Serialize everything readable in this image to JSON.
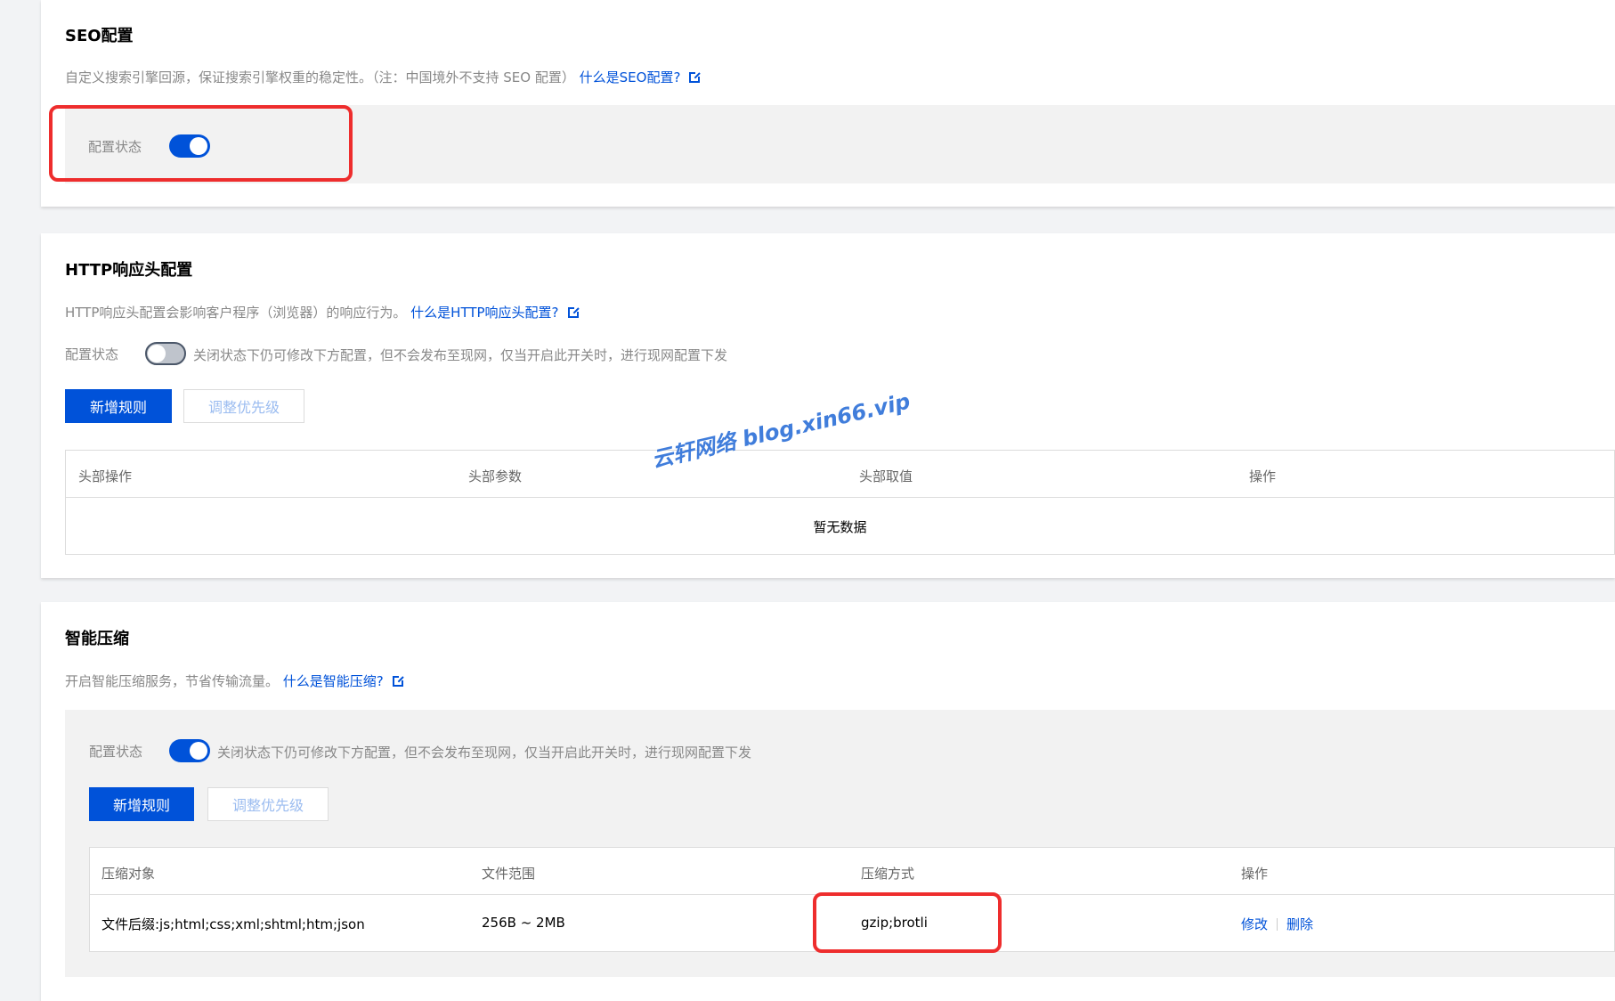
{
  "seo": {
    "title": "SEO配置",
    "desc": "自定义搜索引擎回源，保证搜索引擎权重的稳定性。（注：中国境外不支持 SEO 配置）",
    "link": "什么是SEO配置?",
    "status_label": "配置状态",
    "enabled": true
  },
  "http": {
    "title": "HTTP响应头配置",
    "desc": "HTTP响应头配置会影响客户程序（浏览器）的响应行为。",
    "link": "什么是HTTP响应头配置?",
    "status_label": "配置状态",
    "enabled": false,
    "hint": "关闭状态下仍可修改下方配置，但不会发布至现网，仅当开启此开关时，进行现网配置下发",
    "add_button": "新增规则",
    "priority_button": "调整优先级",
    "columns": [
      "头部操作",
      "头部参数",
      "头部取值",
      "操作"
    ],
    "empty_text": "暂无数据"
  },
  "compression": {
    "title": "智能压缩",
    "desc": "开启智能压缩服务，节省传输流量。",
    "link": "什么是智能压缩?",
    "status_label": "配置状态",
    "enabled": true,
    "hint": "关闭状态下仍可修改下方配置，但不会发布至现网，仅当开启此开关时，进行现网配置下发",
    "add_button": "新增规则",
    "priority_button": "调整优先级",
    "columns": [
      "压缩对象",
      "文件范围",
      "压缩方式",
      "操作"
    ],
    "rows": [
      {
        "object": "文件后缀:js;html;css;xml;shtml;htm;json",
        "range": "256B ~ 2MB",
        "method": "gzip;brotli",
        "edit": "修改",
        "delete": "删除"
      }
    ]
  },
  "watermark": "云轩网络  blog.xin66.vip",
  "colors": {
    "primary": "#0052d9",
    "highlight": "#ee2d2d",
    "background": "#f2f3f5"
  }
}
